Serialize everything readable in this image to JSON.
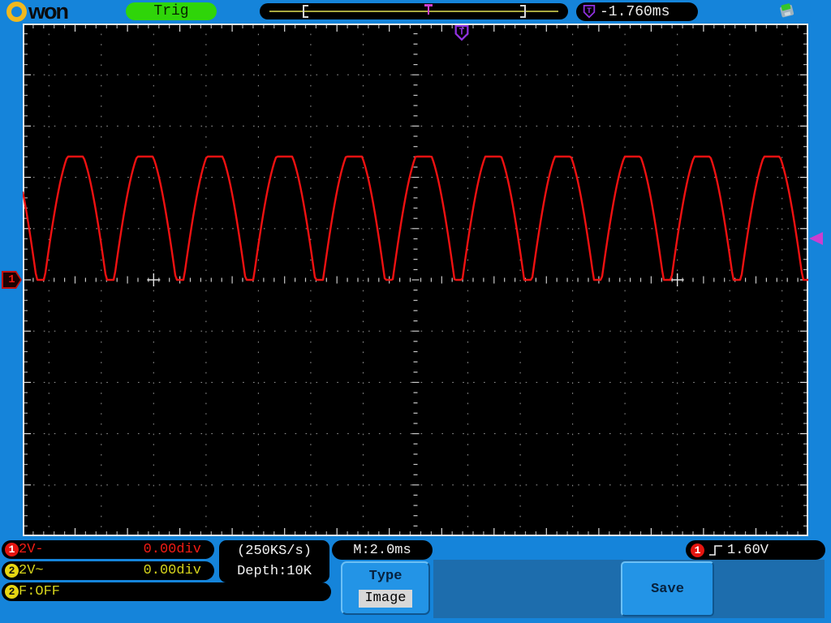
{
  "header": {
    "logo": {
      "brand": "OWON",
      "text": "won"
    },
    "trig_label": "Trig",
    "trigger_readout": "-1.760ms"
  },
  "footer": {
    "ch1_badge": "1",
    "ch1_scale": "2V-",
    "ch1_offset": "0.00div",
    "ch2_badge": "2",
    "ch2_scale": "2V~",
    "ch2_offset": "0.00div",
    "fft_badge": "2",
    "fft_status": "F:OFF",
    "sample_rate": "(250KS/s)",
    "depth": "Depth:10K",
    "timebase": "M:2.0ms",
    "menu_title": "Type",
    "menu_value": "Image",
    "save_label": "Save",
    "trigger_badge": "1",
    "trigger_level": "1.60V"
  },
  "colors": {
    "frame_blue": "#1584da",
    "panel_blue": "#1d6dad",
    "button_blue": "#2394e6",
    "trig_green": "#2fd509",
    "ch1_red": "#e5150f",
    "ch2_yellow": "#d6d41c",
    "wave_red": "#ef1111",
    "trigger_purple": "#9031e0",
    "marker_magenta": "#cb3fcf"
  },
  "chart_data": {
    "type": "line",
    "instrument": "oscilloscope-display",
    "title": "",
    "x_axis": {
      "unit": "ms",
      "ms_per_div": 2.0,
      "divisions": 15,
      "minor_per_div": 5
    },
    "y_axis": {
      "unit": "V",
      "v_per_div": 2.0,
      "divisions": 10,
      "minor_per_div": 5
    },
    "grid": {
      "style": "dotted",
      "cross_marks_div_from_center": 5
    },
    "trigger": {
      "slope": "rising",
      "source_channel": "1",
      "level_v": 1.6,
      "horizontal_offset_ms": -1.76
    },
    "channels": [
      {
        "id": "1",
        "volts_per_div": 2,
        "coupling": "DC",
        "vertical_position_div": 0,
        "color": "#ef1111",
        "visible": true
      },
      {
        "id": "2",
        "volts_per_div": 2,
        "coupling": "AC",
        "vertical_position_div": 0,
        "color": "#d6d41c",
        "visible": false
      }
    ],
    "waveform": {
      "shape": "full-wave rectified sine, flat-clipped at top and bottom",
      "period_ms": 2.66,
      "first_trough_offset_ms": 0.68,
      "model_gain_v": 6.33,
      "model_clip_low_v": 1.11,
      "displayed_peak_v": 4.81
    },
    "sample_rate": "250KS/s",
    "record_depth": "10K"
  }
}
